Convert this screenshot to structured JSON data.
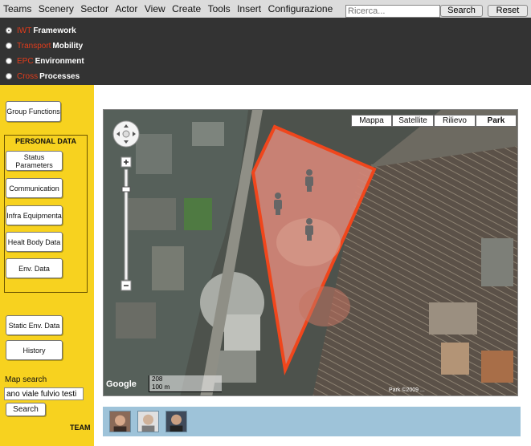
{
  "menubar": {
    "items": [
      "Teams",
      "Scenery",
      "Sector",
      "Actor",
      "View",
      "Create",
      "Tools",
      "Insert",
      "Configurazione"
    ],
    "search_placeholder": "Ricerca...",
    "search_button": "Search",
    "reset_button": "Reset"
  },
  "frameworks": [
    {
      "prefix": "IWT",
      "label": "Framework",
      "selected": true
    },
    {
      "prefix": "Transport",
      "label": "Mobility",
      "selected": false
    },
    {
      "prefix": "EPC",
      "label": "Environment",
      "selected": false
    },
    {
      "prefix": "Cross",
      "label": "Processes",
      "selected": false
    }
  ],
  "sidebar": {
    "group_functions": "Group Functions",
    "personal_data_title": "PERSONAL DATA",
    "personal_buttons": [
      "Status Parameters",
      "Communication",
      "Infra Equipmenta",
      "Healt Body Data",
      "Env. Data"
    ],
    "static_env": "Static Env. Data",
    "history": "History",
    "map_search_label": "Map search",
    "map_search_value": "ano viale fulvio testi",
    "search_button": "Search",
    "team_label": "TEAM"
  },
  "map": {
    "types": [
      "Mappa",
      "Satellite",
      "Rilievo",
      "Park"
    ],
    "active_type": "Park",
    "scale_ft": "208",
    "scale_m": "100 m",
    "copyright": "Park ©2009 ..."
  },
  "colors": {
    "sidebar": "#f7d21f",
    "dark_bar": "#333333",
    "accent": "#e23c1c",
    "team_bar": "#9ec3d9"
  }
}
